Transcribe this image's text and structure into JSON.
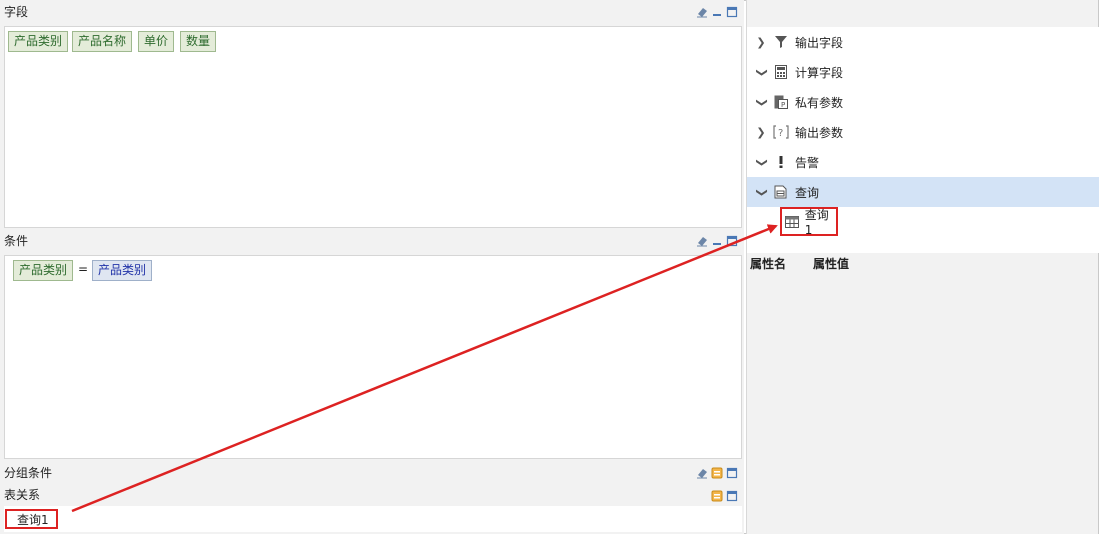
{
  "fields_panel": {
    "title": "字段",
    "chips": [
      "产品类别",
      "产品名称",
      "单价",
      "数量"
    ]
  },
  "conditions_panel": {
    "title": "条件",
    "left_operand": "产品类别",
    "operator": "=",
    "right_operand": "产品类别"
  },
  "group_panel": {
    "title": "分组条件"
  },
  "relations_panel": {
    "title": "表关系",
    "table_tag": "查询1"
  },
  "tree": {
    "items": [
      {
        "label": "输出字段",
        "chevron": ">",
        "icon": "funnel-icon"
      },
      {
        "label": "计算字段",
        "chevron": "v",
        "icon": "calculator-icon"
      },
      {
        "label": "私有参数",
        "chevron": "v",
        "icon": "private-param-icon"
      },
      {
        "label": "输出参数",
        "chevron": ">",
        "icon": "question-bracket-icon"
      },
      {
        "label": "告警",
        "chevron": "v",
        "icon": "exclamation-icon"
      },
      {
        "label": "查询",
        "chevron": "v",
        "icon": "query-icon"
      }
    ],
    "child": {
      "label": "查询1",
      "icon": "table-icon"
    }
  },
  "properties": {
    "name_header": "属性名",
    "value_header": "属性值"
  },
  "colors": {
    "accent_red": "#dd2222",
    "selected_row": "#d3e3f6",
    "chip_green_bg": "#e4ecd9",
    "chip_blue_bg": "#dfe6f1"
  }
}
